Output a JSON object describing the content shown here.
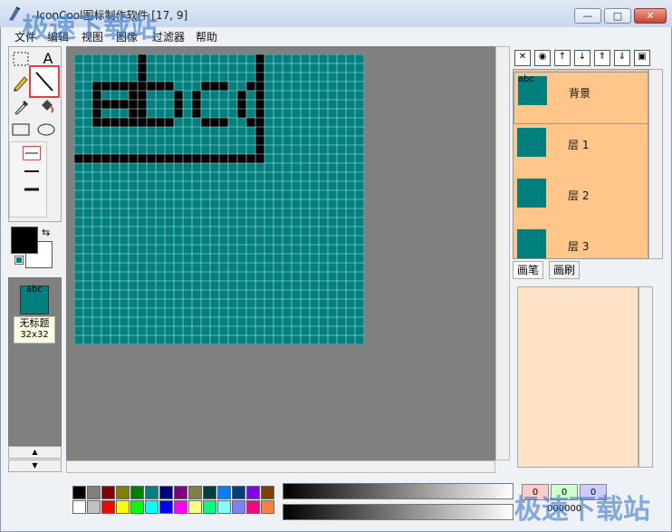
{
  "window": {
    "title": "IconCool图标制作软件 [17, 9]",
    "minimize_label": "—",
    "maximize_label": "□",
    "close_label": "✕"
  },
  "menu": {
    "items": [
      "文件",
      "编辑",
      "视图",
      "图像",
      "过滤器",
      "帮助"
    ]
  },
  "tools": {
    "selected": "line-tool",
    "text_tool_label": "A"
  },
  "document": {
    "name": "无标题",
    "size": "32x32",
    "thumb_text": "abc"
  },
  "canvas": {
    "grid_size": 32,
    "fill_color": "#00807f",
    "draw_color": "#000000",
    "pixel_text": "abc",
    "cursor_position": "[17, 9]"
  },
  "layers": {
    "items": [
      {
        "name": "背景",
        "thumb_text": "abc"
      },
      {
        "name": "层 1",
        "thumb_text": ""
      },
      {
        "name": "层 2",
        "thumb_text": ""
      },
      {
        "name": "层 3",
        "thumb_text": ""
      }
    ],
    "selected_index": 0,
    "panel_color": "#ffc589"
  },
  "tabs": {
    "items": [
      "画笔",
      "画刷"
    ],
    "active_index": 0
  },
  "colors": {
    "foreground": "#000000",
    "background": "#ffffff",
    "swatch_row1": [
      "#000000",
      "#808080",
      "#800000",
      "#808000",
      "#008000",
      "#008080",
      "#000080",
      "#800080",
      "#808040",
      "#004040",
      "#0080ff",
      "#004080",
      "#8000ff",
      "#804000"
    ],
    "swatch_row2": [
      "#ffffff",
      "#c0c0c0",
      "#ff0000",
      "#ffff00",
      "#00ff00",
      "#00ffff",
      "#0000ff",
      "#ff00ff",
      "#ffff80",
      "#00ff80",
      "#80ffff",
      "#8080ff",
      "#ff0080",
      "#ff8040"
    ],
    "rgb_values": [
      "0",
      "0",
      "0"
    ],
    "hex_value": "000000"
  },
  "watermark": {
    "top": "极速下载站",
    "bottom": "极速下载站"
  }
}
